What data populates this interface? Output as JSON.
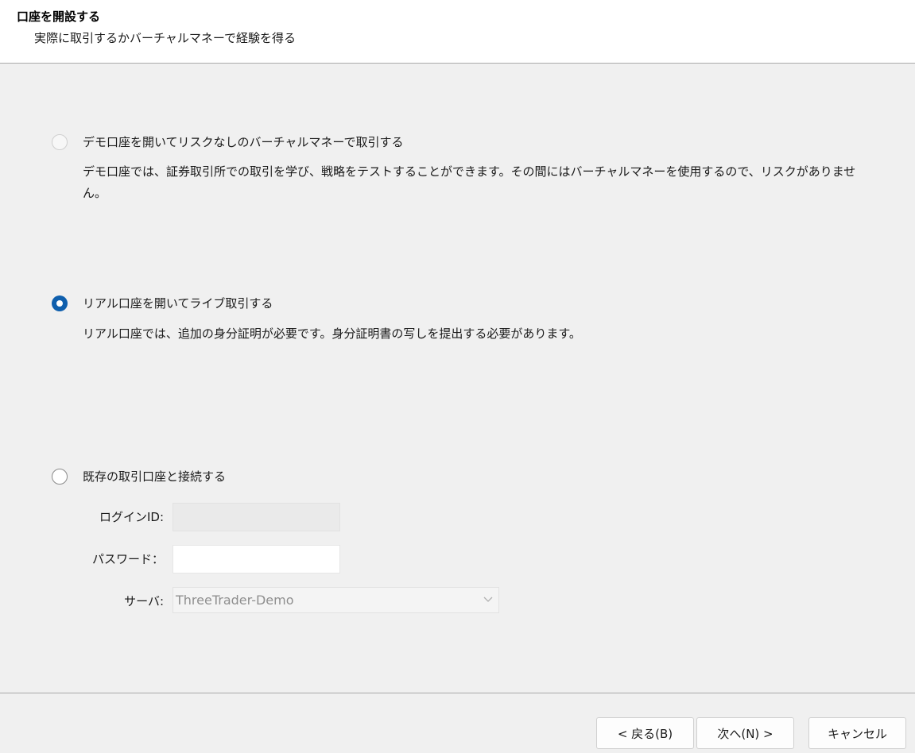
{
  "header": {
    "title": "口座を開設する",
    "subtitle": "実際に取引するかバーチャルマネーで経験を得る"
  },
  "options": [
    {
      "label": "デモ口座を開いてリスクなしのバーチャルマネーで取引する",
      "description": "デモ口座では、証券取引所での取引を学び、戦略をテストすることができます。その間にはバーチャルマネーを使用するので、リスクがありません。",
      "selected": false
    },
    {
      "label": "リアル口座を開いてライブ取引する",
      "description": "リアル口座では、追加の身分証明が必要です。身分証明書の写しを提出する必要があります。",
      "selected": true
    },
    {
      "label": "既存の取引口座と接続する",
      "selected": false
    }
  ],
  "existing_account": {
    "login_label": "ログインID:",
    "login_value": "",
    "password_label": "パスワード：",
    "password_value": "",
    "server_label": "サーバ:",
    "server_value": "ThreeTrader-Demo"
  },
  "footer": {
    "back_label": "< 戻る(B)",
    "next_label": "次へ(N) >",
    "cancel_label": "キャンセル"
  },
  "colors": {
    "accent": "#0f5fad",
    "header_bg": "#ffffff",
    "body_bg": "#f0f0f0"
  }
}
